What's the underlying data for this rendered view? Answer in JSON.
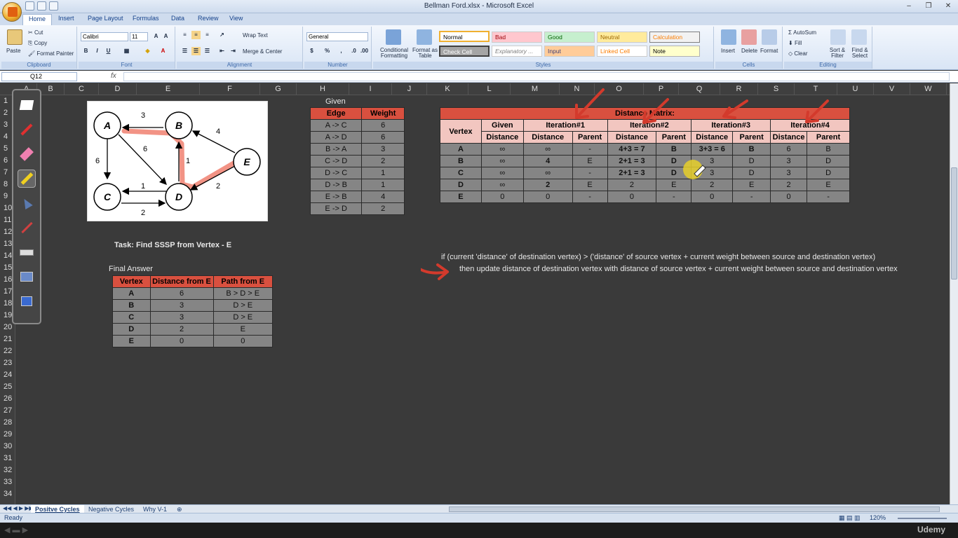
{
  "window": {
    "title": "Bellman Ford.xlsx - Microsoft Excel"
  },
  "tabs": [
    "Home",
    "Insert",
    "Page Layout",
    "Formulas",
    "Data",
    "Review",
    "View"
  ],
  "ribbon": {
    "clipboard": {
      "paste": "Paste",
      "cut": "Cut",
      "copy": "Copy",
      "format_painter": "Format Painter",
      "label": "Clipboard"
    },
    "font": {
      "name": "Calibri",
      "size": "11",
      "label": "Font"
    },
    "alignment": {
      "wrap": "Wrap Text",
      "merge": "Merge & Center",
      "label": "Alignment"
    },
    "number": {
      "format": "General",
      "label": "Number"
    },
    "styles": {
      "conditional": "Conditional Formatting",
      "format_table": "Format as Table",
      "label": "Styles",
      "cells": [
        "Normal",
        "Bad",
        "Good",
        "Neutral",
        "Calculation",
        "Check Cell",
        "Explanatory ...",
        "Input",
        "Linked Cell",
        "Note"
      ]
    },
    "cells": {
      "insert": "Insert",
      "delete": "Delete",
      "format": "Format",
      "label": "Cells"
    },
    "editing": {
      "autosum": "AutoSum",
      "fill": "Fill",
      "clear": "Clear",
      "sort": "Sort & Filter",
      "find": "Find & Select",
      "label": "Editing"
    }
  },
  "formula_bar": {
    "name_box": "Q12",
    "fx": "fx",
    "content": ""
  },
  "columns": [
    "A",
    "B",
    "C",
    "D",
    "E",
    "F",
    "G",
    "H",
    "I",
    "J",
    "K",
    "L",
    "M",
    "N",
    "O",
    "P",
    "Q",
    "R",
    "S",
    "T",
    "U",
    "V",
    "W"
  ],
  "rows": [
    "1",
    "2",
    "3",
    "4",
    "5",
    "6",
    "7",
    "8",
    "9",
    "10",
    "11",
    "12",
    "13",
    "14",
    "15",
    "16",
    "17",
    "18",
    "19",
    "20",
    "21",
    "22",
    "23",
    "24",
    "25",
    "26",
    "27",
    "28",
    "29",
    "30",
    "31",
    "32",
    "33",
    "34"
  ],
  "graph": {
    "nodes": [
      "A",
      "B",
      "C",
      "D",
      "E"
    ],
    "weights": [
      "3",
      "6",
      "6",
      "1",
      "4",
      "1",
      "2",
      "2"
    ]
  },
  "given": {
    "caption": "Given",
    "headers": [
      "Edge",
      "Weight"
    ],
    "rows": [
      [
        "A -> C",
        "6"
      ],
      [
        "A -> D",
        "6"
      ],
      [
        "B -> A",
        "3"
      ],
      [
        "C -> D",
        "2"
      ],
      [
        "D -> C",
        "1"
      ],
      [
        "D -> B",
        "1"
      ],
      [
        "E -> B",
        "4"
      ],
      [
        "E -> D",
        "2"
      ]
    ]
  },
  "matrix": {
    "title": "Distance Matrix:",
    "vertex": "Vertex",
    "given_top": "Given",
    "given_bottom": "Distance",
    "iterations": [
      "Iteration#1",
      "Iteration#2",
      "Iteration#3",
      "Iteration#4"
    ],
    "sub": [
      "Distance",
      "Parent"
    ],
    "rows": [
      [
        "A",
        "∞",
        "∞",
        "-",
        "4+3 = 7",
        "B",
        "3+3 = 6",
        "B",
        "6",
        "B"
      ],
      [
        "B",
        "∞",
        "4",
        "E",
        "2+1 = 3",
        "D",
        "3",
        "D",
        "3",
        "D"
      ],
      [
        "C",
        "∞",
        "∞",
        "-",
        "2+1 = 3",
        "D",
        "3",
        "D",
        "3",
        "D"
      ],
      [
        "D",
        "∞",
        "2",
        "E",
        "2",
        "E",
        "2",
        "E",
        "2",
        "E"
      ],
      [
        "E",
        "0",
        "0",
        "-",
        "0",
        "-",
        "0",
        "-",
        "0",
        "-"
      ]
    ]
  },
  "task": "Task: Find SSSP from Vertex - E",
  "final": {
    "caption": "Final Answer",
    "headers": [
      "Vertex",
      "Distance from E",
      "Path from E"
    ],
    "rows": [
      [
        "A",
        "6",
        "B > D > E"
      ],
      [
        "B",
        "3",
        "D > E"
      ],
      [
        "C",
        "3",
        "D > E"
      ],
      [
        "D",
        "2",
        "E"
      ],
      [
        "E",
        "0",
        "0"
      ]
    ]
  },
  "rule_line1": "if (current 'distance' of destination vertex) > ('distance' of source vertex + current weight between source and destination vertex)",
  "rule_line2": "then update distance of destination vertex with distance of source vertex + current weight between source and destination vertex",
  "sheet_tabs": [
    "Positve Cycles",
    "Negative Cycles",
    "Why V-1"
  ],
  "status": {
    "ready": "Ready",
    "zoom": "120%"
  },
  "player": {
    "brand": "Udemy"
  },
  "colors": {
    "header_red": "#d9503f",
    "header_pink": "#f2c6c0",
    "cell_gray": "#858585",
    "annotation_red": "#d33a2c",
    "sheet_bg": "#3a3a3a"
  }
}
